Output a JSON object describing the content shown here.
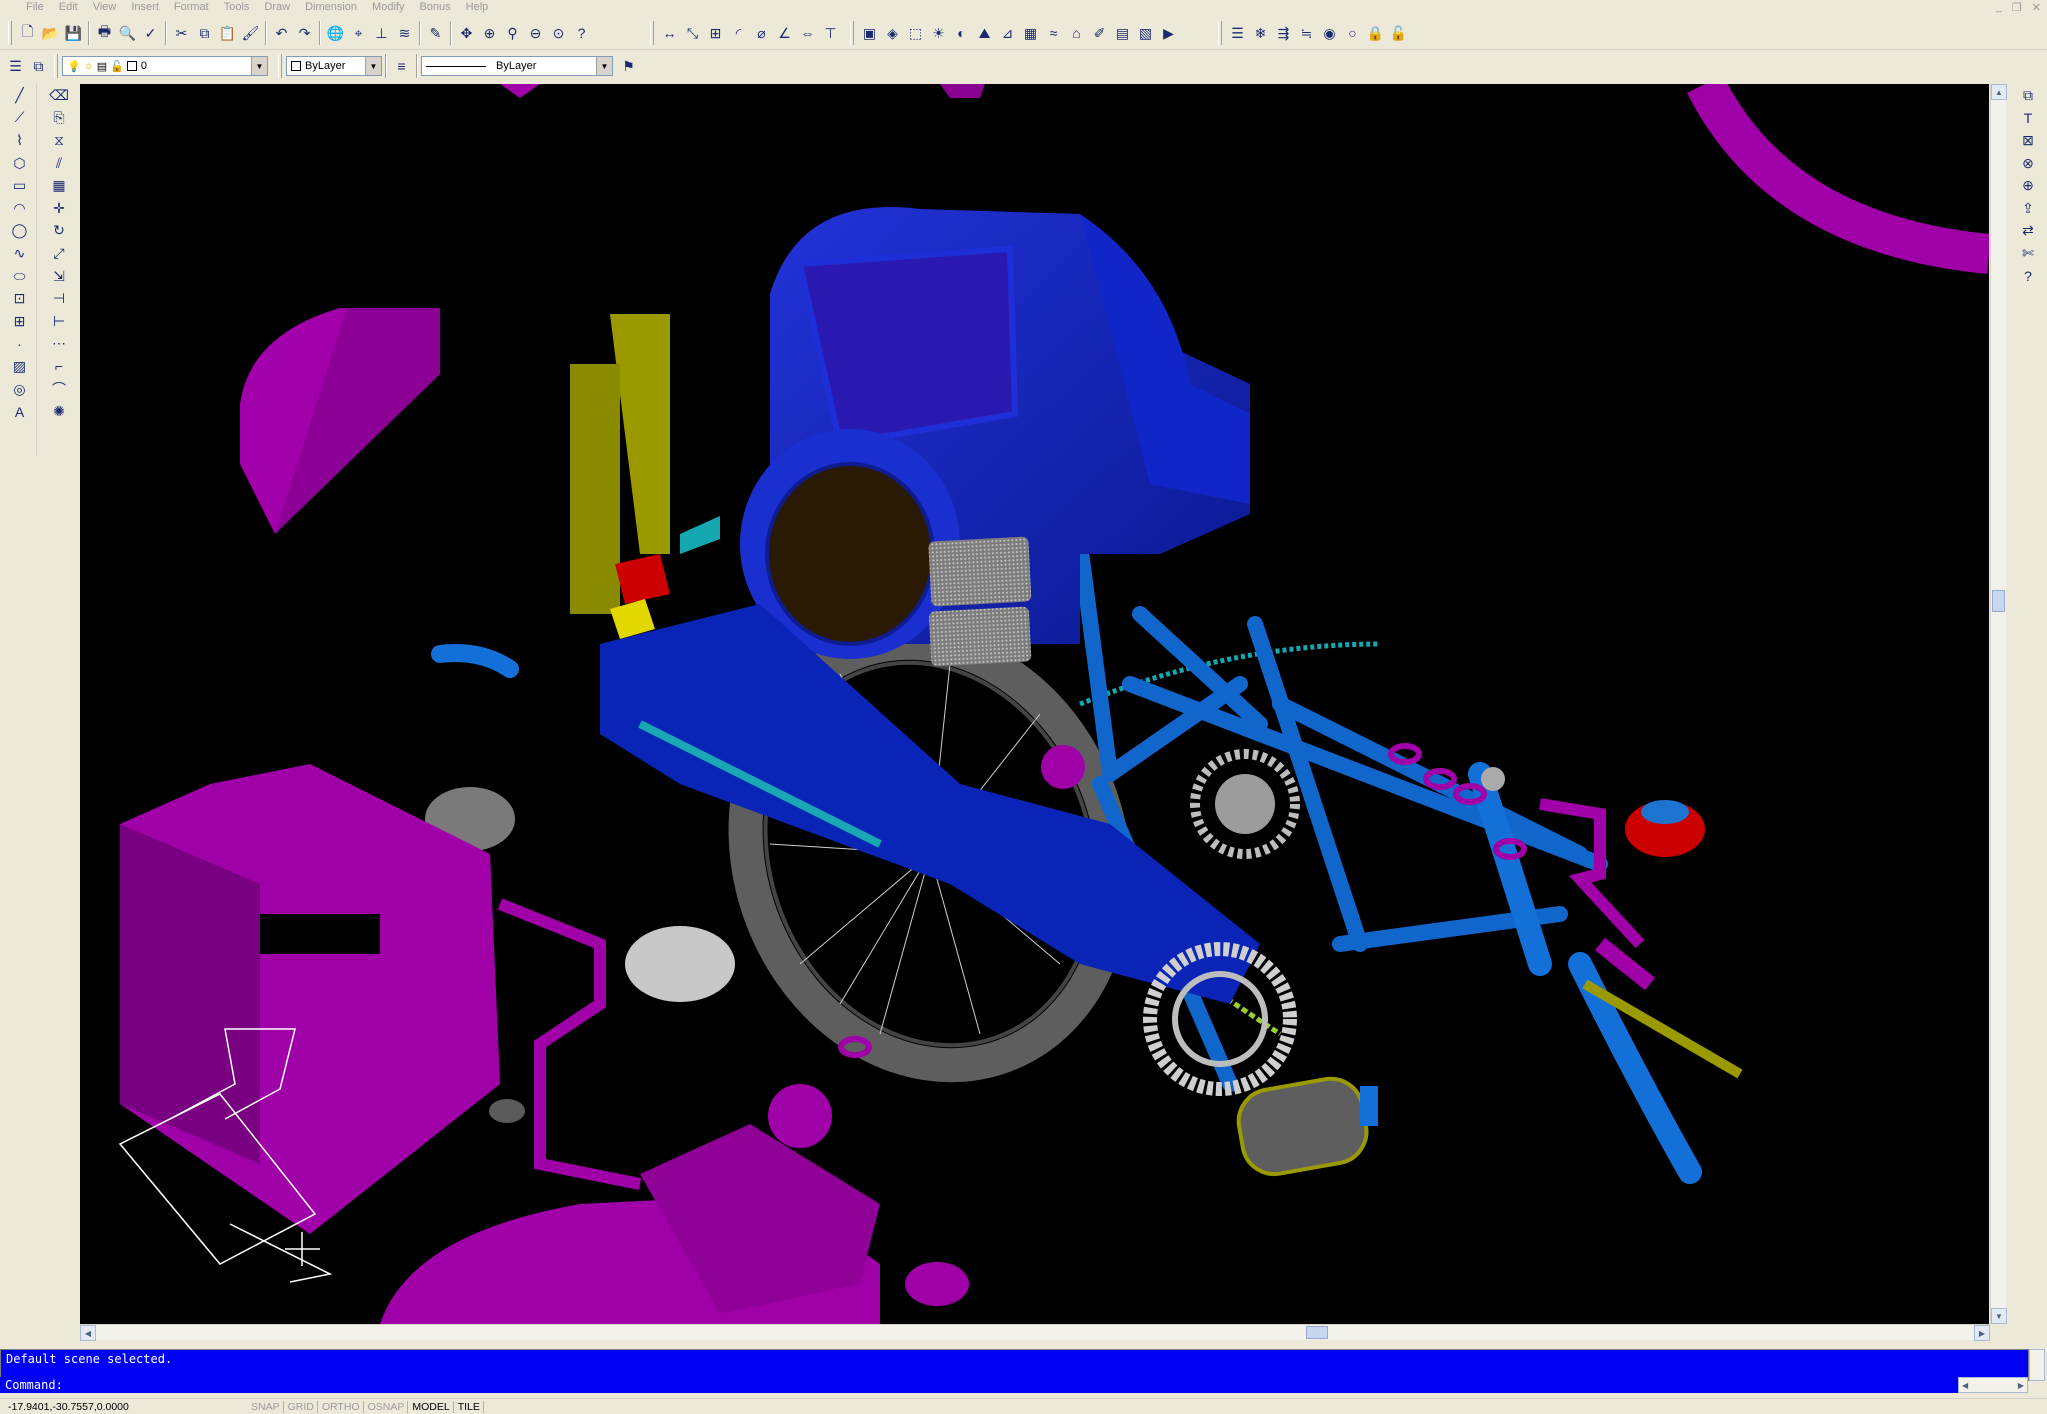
{
  "menu": [
    "File",
    "Edit",
    "View",
    "Insert",
    "Format",
    "Tools",
    "Draw",
    "Dimension",
    "Modify",
    "Bonus",
    "Help"
  ],
  "window_controls": [
    "_",
    "❐",
    "✕"
  ],
  "layer_combo": {
    "value": "0"
  },
  "color_combo": {
    "value": "ByLayer"
  },
  "linetype_combo": {
    "value": "ByLayer"
  },
  "command": {
    "history": "Default scene selected.",
    "prompt": "Command:"
  },
  "status": {
    "coords": "-17.9401,-30.7557,0.0000",
    "toggles": [
      {
        "label": "SNAP",
        "on": false
      },
      {
        "label": "GRID",
        "on": false
      },
      {
        "label": "ORTHO",
        "on": false
      },
      {
        "label": "OSNAP",
        "on": false
      },
      {
        "label": "MODEL",
        "on": true
      },
      {
        "label": "TILE",
        "on": true
      }
    ]
  },
  "toolbars": {
    "standard": [
      "new-icon",
      "open-icon",
      "save-icon",
      "|",
      "print-icon",
      "preview-icon",
      "spellcheck-icon",
      "|",
      "cut-icon",
      "copy-icon",
      "paste-icon",
      "match-properties-icon",
      "|",
      "undo-icon",
      "redo-icon",
      "|",
      "hyperlink-icon",
      "object-snap-icon",
      "ucs-icon",
      "inquiry-icon",
      "|",
      "redraw-icon",
      "|",
      "pan-icon",
      "zoom-window-icon",
      "zoom-icon",
      "zoom-previous-icon",
      "zoom-extents-icon",
      "help-icon"
    ],
    "dimension": [
      "linear-dim-icon",
      "aligned-dim-icon",
      "ordinate-dim-icon",
      "radius-dim-icon",
      "diameter-dim-icon",
      "angular-dim-icon",
      "quick-dim-icon",
      "baseline-dim-icon"
    ],
    "render": [
      "hide-icon",
      "render-icon",
      "scene-icon",
      "light-icon",
      "materials-icon",
      "landscape-icon",
      "mapping-icon",
      "background-icon",
      "fog-icon",
      "landscape-new-icon",
      "landscape-edit-icon",
      "landscape-library-icon",
      "save-image-icon",
      "replay-icon"
    ],
    "layers": [
      "layer-states-icon",
      "layer-freeze-icon",
      "layer-walk-icon",
      "layer-match-icon",
      "layer-isolate-icon",
      "layer-off-icon",
      "layer-lock-icon",
      "layer-unlock-icon"
    ],
    "draw": [
      "line-icon",
      "construction-line-icon",
      "polyline-icon",
      "polygon-icon",
      "rectangle-icon",
      "arc-icon",
      "circle-icon",
      "spline-icon",
      "ellipse-icon",
      "insert-block-icon",
      "make-block-icon",
      "point-icon",
      "hatch-icon",
      "region-icon",
      "multiline-text-icon"
    ],
    "modify": [
      "erase-icon",
      "copy-object-icon",
      "mirror-icon",
      "offset-icon",
      "array-icon",
      "move-icon",
      "rotate-icon",
      "scale-icon",
      "stretch-icon",
      "trim-icon",
      "extend-icon",
      "break-icon",
      "chamfer-icon",
      "fillet-icon",
      "explode-icon"
    ],
    "bonus": [
      "bonus-layer-icon",
      "bonus-text-icon",
      "bonus-block-icon",
      "bonus-purge-icon",
      "bonus-attach-icon",
      "bonus-extract-icon",
      "bonus-replace-icon",
      "bonus-trim-icon",
      "bonus-help-icon"
    ]
  },
  "colors": {
    "viewport_bg": "#000000",
    "cmd_bg": "#0000f4",
    "frame_blue": "#1a4fd0",
    "frame_tube": "#1166cc",
    "magenta": "#a000a8",
    "olive": "#9a9a00",
    "dark_brown": "#2a1a04",
    "wheel_gray": "#5e5e5e",
    "red": "#cc0000",
    "yellow": "#e2d800",
    "cyan": "#16a8b0",
    "light_gray": "#c8c8c8"
  }
}
